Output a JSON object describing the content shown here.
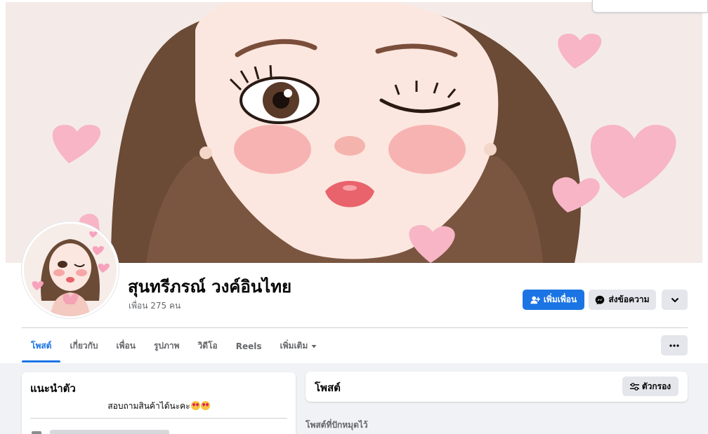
{
  "profile": {
    "name": "สุนทรีภรณ์ วงค์อินไทย",
    "friends_count": "เพื่อน 275 คน"
  },
  "actions": {
    "add_friend": "เพิ่มเพื่อน",
    "message": "ส่งข้อความ",
    "more_icon": "chevron-down-icon"
  },
  "tabs": [
    {
      "label": "โพสต์",
      "active": true
    },
    {
      "label": "เกี่ยวกับ",
      "active": false
    },
    {
      "label": "เพื่อน",
      "active": false
    },
    {
      "label": "รูปภาพ",
      "active": false
    },
    {
      "label": "วิดีโอ",
      "active": false
    },
    {
      "label": "Reels",
      "active": false
    },
    {
      "label": "เพิ่มเติม",
      "active": false
    }
  ],
  "intro": {
    "title": "แนะนำตัว",
    "bio": "สอบถามสินค้าได้นะคะ"
  },
  "posts": {
    "title": "โพสต์",
    "filter_label": "ตัวกรอง",
    "pinned_label": "โพสต์ที่ปักหมุดไว้"
  },
  "colors": {
    "accent": "#1b74e4",
    "page_bg": "#f0f2f5",
    "button_gray": "#e4e6eb"
  }
}
